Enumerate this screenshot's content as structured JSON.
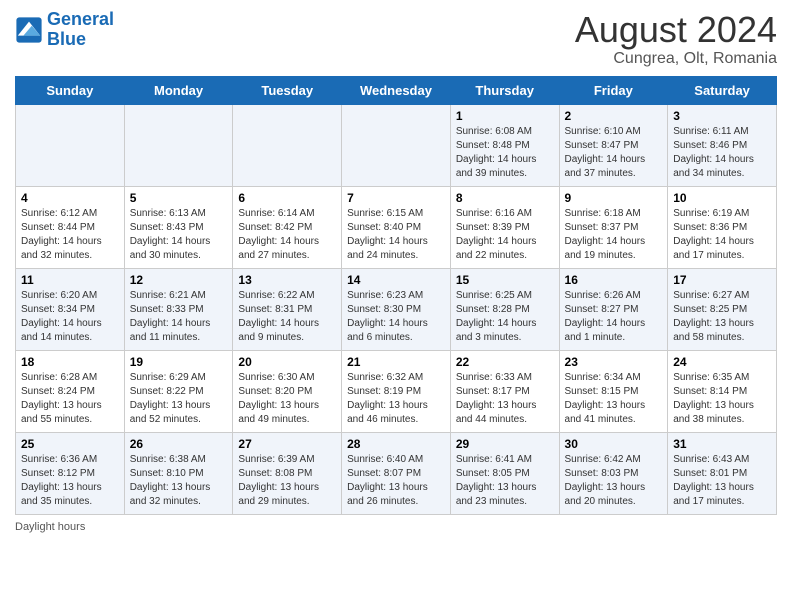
{
  "header": {
    "logo_line1": "General",
    "logo_line2": "Blue",
    "month_year": "August 2024",
    "location": "Cungrea, Olt, Romania"
  },
  "days_of_week": [
    "Sunday",
    "Monday",
    "Tuesday",
    "Wednesday",
    "Thursday",
    "Friday",
    "Saturday"
  ],
  "weeks": [
    [
      {
        "day": "",
        "info": ""
      },
      {
        "day": "",
        "info": ""
      },
      {
        "day": "",
        "info": ""
      },
      {
        "day": "",
        "info": ""
      },
      {
        "day": "1",
        "info": "Sunrise: 6:08 AM\nSunset: 8:48 PM\nDaylight: 14 hours and 39 minutes."
      },
      {
        "day": "2",
        "info": "Sunrise: 6:10 AM\nSunset: 8:47 PM\nDaylight: 14 hours and 37 minutes."
      },
      {
        "day": "3",
        "info": "Sunrise: 6:11 AM\nSunset: 8:46 PM\nDaylight: 14 hours and 34 minutes."
      }
    ],
    [
      {
        "day": "4",
        "info": "Sunrise: 6:12 AM\nSunset: 8:44 PM\nDaylight: 14 hours and 32 minutes."
      },
      {
        "day": "5",
        "info": "Sunrise: 6:13 AM\nSunset: 8:43 PM\nDaylight: 14 hours and 30 minutes."
      },
      {
        "day": "6",
        "info": "Sunrise: 6:14 AM\nSunset: 8:42 PM\nDaylight: 14 hours and 27 minutes."
      },
      {
        "day": "7",
        "info": "Sunrise: 6:15 AM\nSunset: 8:40 PM\nDaylight: 14 hours and 24 minutes."
      },
      {
        "day": "8",
        "info": "Sunrise: 6:16 AM\nSunset: 8:39 PM\nDaylight: 14 hours and 22 minutes."
      },
      {
        "day": "9",
        "info": "Sunrise: 6:18 AM\nSunset: 8:37 PM\nDaylight: 14 hours and 19 minutes."
      },
      {
        "day": "10",
        "info": "Sunrise: 6:19 AM\nSunset: 8:36 PM\nDaylight: 14 hours and 17 minutes."
      }
    ],
    [
      {
        "day": "11",
        "info": "Sunrise: 6:20 AM\nSunset: 8:34 PM\nDaylight: 14 hours and 14 minutes."
      },
      {
        "day": "12",
        "info": "Sunrise: 6:21 AM\nSunset: 8:33 PM\nDaylight: 14 hours and 11 minutes."
      },
      {
        "day": "13",
        "info": "Sunrise: 6:22 AM\nSunset: 8:31 PM\nDaylight: 14 hours and 9 minutes."
      },
      {
        "day": "14",
        "info": "Sunrise: 6:23 AM\nSunset: 8:30 PM\nDaylight: 14 hours and 6 minutes."
      },
      {
        "day": "15",
        "info": "Sunrise: 6:25 AM\nSunset: 8:28 PM\nDaylight: 14 hours and 3 minutes."
      },
      {
        "day": "16",
        "info": "Sunrise: 6:26 AM\nSunset: 8:27 PM\nDaylight: 14 hours and 1 minute."
      },
      {
        "day": "17",
        "info": "Sunrise: 6:27 AM\nSunset: 8:25 PM\nDaylight: 13 hours and 58 minutes."
      }
    ],
    [
      {
        "day": "18",
        "info": "Sunrise: 6:28 AM\nSunset: 8:24 PM\nDaylight: 13 hours and 55 minutes."
      },
      {
        "day": "19",
        "info": "Sunrise: 6:29 AM\nSunset: 8:22 PM\nDaylight: 13 hours and 52 minutes."
      },
      {
        "day": "20",
        "info": "Sunrise: 6:30 AM\nSunset: 8:20 PM\nDaylight: 13 hours and 49 minutes."
      },
      {
        "day": "21",
        "info": "Sunrise: 6:32 AM\nSunset: 8:19 PM\nDaylight: 13 hours and 46 minutes."
      },
      {
        "day": "22",
        "info": "Sunrise: 6:33 AM\nSunset: 8:17 PM\nDaylight: 13 hours and 44 minutes."
      },
      {
        "day": "23",
        "info": "Sunrise: 6:34 AM\nSunset: 8:15 PM\nDaylight: 13 hours and 41 minutes."
      },
      {
        "day": "24",
        "info": "Sunrise: 6:35 AM\nSunset: 8:14 PM\nDaylight: 13 hours and 38 minutes."
      }
    ],
    [
      {
        "day": "25",
        "info": "Sunrise: 6:36 AM\nSunset: 8:12 PM\nDaylight: 13 hours and 35 minutes."
      },
      {
        "day": "26",
        "info": "Sunrise: 6:38 AM\nSunset: 8:10 PM\nDaylight: 13 hours and 32 minutes."
      },
      {
        "day": "27",
        "info": "Sunrise: 6:39 AM\nSunset: 8:08 PM\nDaylight: 13 hours and 29 minutes."
      },
      {
        "day": "28",
        "info": "Sunrise: 6:40 AM\nSunset: 8:07 PM\nDaylight: 13 hours and 26 minutes."
      },
      {
        "day": "29",
        "info": "Sunrise: 6:41 AM\nSunset: 8:05 PM\nDaylight: 13 hours and 23 minutes."
      },
      {
        "day": "30",
        "info": "Sunrise: 6:42 AM\nSunset: 8:03 PM\nDaylight: 13 hours and 20 minutes."
      },
      {
        "day": "31",
        "info": "Sunrise: 6:43 AM\nSunset: 8:01 PM\nDaylight: 13 hours and 17 minutes."
      }
    ]
  ],
  "footer": {
    "daylight_label": "Daylight hours"
  }
}
